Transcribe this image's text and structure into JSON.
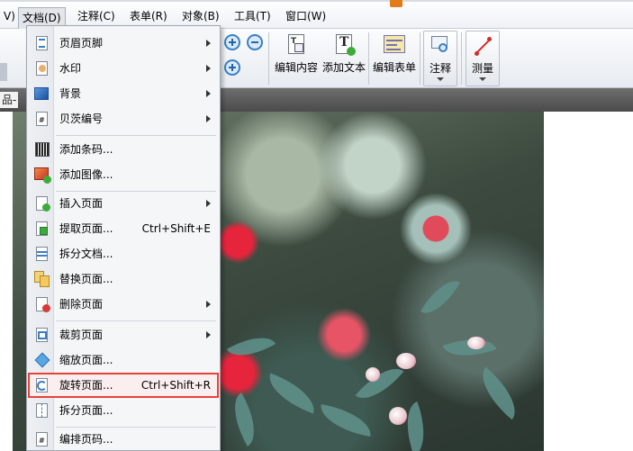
{
  "menubar": {
    "items": [
      {
        "label": "V)"
      },
      {
        "label": "文档(D)"
      },
      {
        "label": "注释(C)"
      },
      {
        "label": "表单(R)"
      },
      {
        "label": "对象(B)"
      },
      {
        "label": "工具(T)"
      },
      {
        "label": "窗口(W)"
      }
    ]
  },
  "toolbar": {
    "edit_content_label": "编辑内容",
    "add_text_label": "添加文本",
    "edit_form_label": "编辑表单",
    "comment_label": "注释",
    "measure_label": "测量"
  },
  "tab": {
    "label": "品-"
  },
  "menu": {
    "items": [
      {
        "label": "页眉页脚",
        "shortcut": "",
        "icon": "header-footer-icon"
      },
      {
        "label": "水印",
        "shortcut": "",
        "icon": "watermark-icon"
      },
      {
        "label": "背景",
        "shortcut": "",
        "icon": "background-icon"
      },
      {
        "label": "贝茨编号",
        "shortcut": "",
        "icon": "bates-numbering-icon"
      },
      {
        "label": "添加条码...",
        "shortcut": "",
        "icon": "barcode-icon"
      },
      {
        "label": "添加图像...",
        "shortcut": "",
        "icon": "add-image-icon"
      },
      {
        "label": "插入页面",
        "shortcut": "",
        "icon": "insert-page-icon"
      },
      {
        "label": "提取页面...",
        "shortcut": "Ctrl+Shift+E",
        "icon": "extract-page-icon"
      },
      {
        "label": "拆分文档...",
        "shortcut": "",
        "icon": "split-document-icon"
      },
      {
        "label": "替换页面...",
        "shortcut": "",
        "icon": "replace-page-icon"
      },
      {
        "label": "删除页面",
        "shortcut": "",
        "icon": "delete-page-icon"
      },
      {
        "label": "裁剪页面",
        "shortcut": "",
        "icon": "crop-page-icon"
      },
      {
        "label": "缩放页面...",
        "shortcut": "",
        "icon": "scale-page-icon"
      },
      {
        "label": "旋转页面...",
        "shortcut": "Ctrl+Shift+R",
        "icon": "rotate-page-icon"
      },
      {
        "label": "拆分页面...",
        "shortcut": "",
        "icon": "split-page-icon"
      },
      {
        "label": "编排页码...",
        "shortcut": "",
        "icon": "page-numbering-icon"
      }
    ]
  },
  "colors": {
    "highlight_border": "#e8413b",
    "menu_bg": "#f5f6f8"
  }
}
